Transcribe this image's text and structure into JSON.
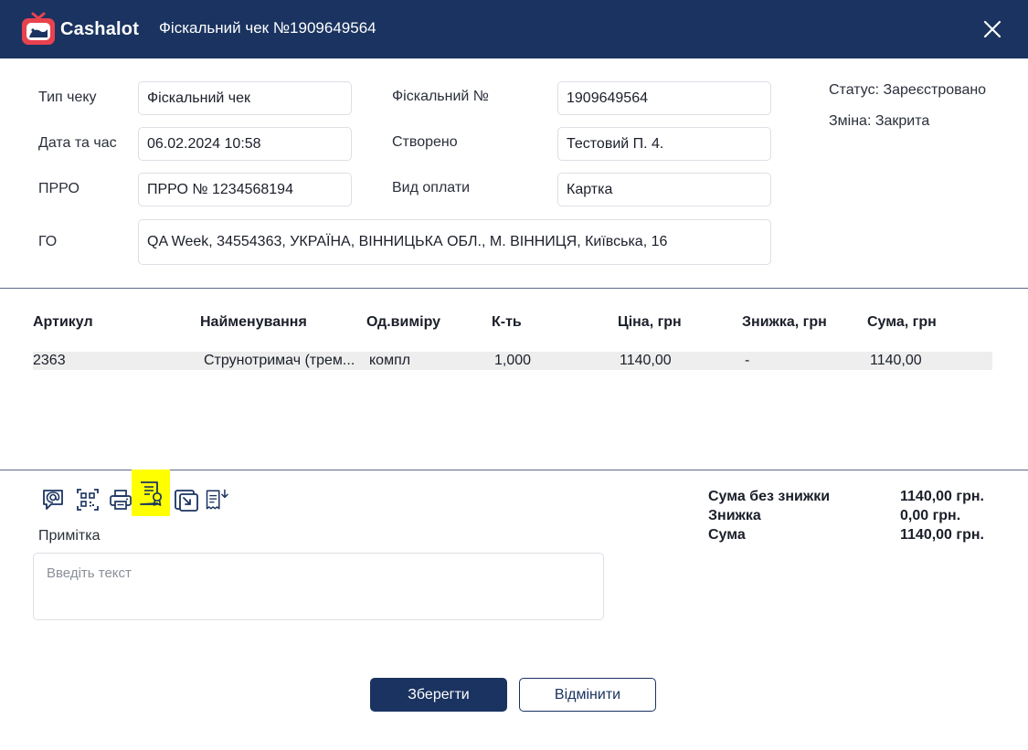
{
  "app": {
    "brand": "Cashalot",
    "title": "Фіскальний чек №1909649564"
  },
  "form": {
    "type_label": "Тип чеку",
    "type_value": "Фіскальний чек",
    "date_label": "Дата та час",
    "date_value": "06.02.2024 10:58",
    "prro_label": "ПРРО",
    "prro_value": "ПРРО № 1234568194",
    "go_label": "ГО",
    "go_value": "QA Week, 34554363, УКРАЇНА, ВІННИЦЬКА ОБЛ., М. ВІННИЦЯ, Київська, 16",
    "fiscal_label": "Фіскальний №",
    "fiscal_value": "1909649564",
    "created_label": "Створено",
    "created_value": "Тестовий П. 4.",
    "payment_label": "Вид оплати",
    "payment_value": "Картка"
  },
  "status": {
    "status": "Статус: Зареєстровано",
    "shift": "Зміна: Закрита"
  },
  "table": {
    "headers": [
      "Артикул",
      "Найменування",
      "Од.виміру",
      "К-ть",
      "Ціна, грн",
      "Знижка, грн",
      "Сума, грн"
    ],
    "rows": [
      [
        "2363",
        "Струнотримач (трем...",
        "компл",
        "1,000",
        "1140,00",
        "-",
        "1140,00"
      ]
    ]
  },
  "toolbar": {
    "icons": [
      "email-icon",
      "qr-code-icon",
      "print-icon",
      "certificate-icon",
      "export-icon",
      "download-receipt-icon"
    ],
    "highlighted_color": "#ffff00"
  },
  "note": {
    "label": "Примітка",
    "placeholder": "Введіть текст",
    "value": ""
  },
  "totals": {
    "subtotal_label": "Сума без знижки",
    "subtotal_value": "1140,00 грн.",
    "discount_label": "Знижка",
    "discount_value": "0,00 грн.",
    "total_label": "Сума",
    "total_value": "1140,00 грн."
  },
  "buttons": {
    "save": "Зберегти",
    "cancel": "Відмінити"
  },
  "colors": {
    "header_bg": "#1a3360",
    "accent": "#1a3360",
    "logo_red": "#e8424f"
  }
}
